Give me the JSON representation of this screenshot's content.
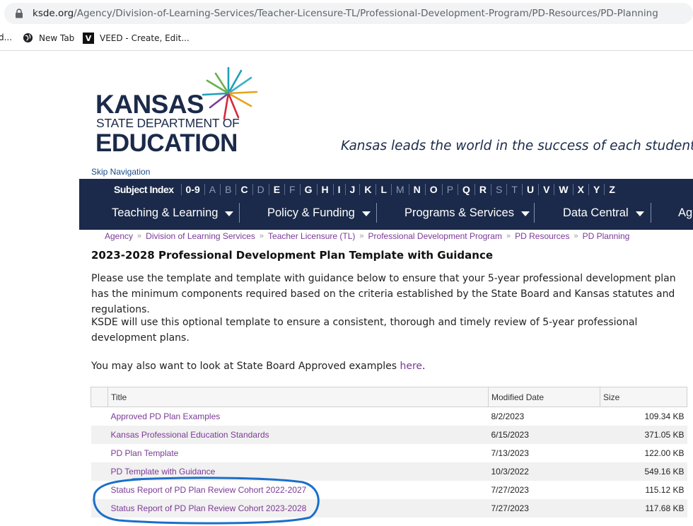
{
  "browser": {
    "url_domain": "ksde.org",
    "url_path": "/Agency/Division-of-Learning-Services/Teacher-Licensure-TL/Professional-Development-Program/PD-Resources/PD-Planning",
    "bookmarks": [
      "d...",
      "New Tab",
      "VEED - Create, Edit..."
    ]
  },
  "header": {
    "logo_line1": "KANSAS",
    "logo_line2": "STATE DEPARTMENT OF",
    "logo_line3": "EDUCATION",
    "tagline": "Kansas leads the world in the success of each student.",
    "skip_nav": "Skip Navigation"
  },
  "nav": {
    "subject_index": "Subject Index",
    "index_items": [
      {
        "label": "0-9",
        "dim": false
      },
      {
        "label": "A",
        "dim": true
      },
      {
        "label": "B",
        "dim": true
      },
      {
        "label": "C",
        "dim": false
      },
      {
        "label": "D",
        "dim": true
      },
      {
        "label": "E",
        "dim": false
      },
      {
        "label": "F",
        "dim": true
      },
      {
        "label": "G",
        "dim": false
      },
      {
        "label": "H",
        "dim": false
      },
      {
        "label": "I",
        "dim": false
      },
      {
        "label": "J",
        "dim": false
      },
      {
        "label": "K",
        "dim": false
      },
      {
        "label": "L",
        "dim": false
      },
      {
        "label": "M",
        "dim": true
      },
      {
        "label": "N",
        "dim": false
      },
      {
        "label": "O",
        "dim": false
      },
      {
        "label": "P",
        "dim": true
      },
      {
        "label": "Q",
        "dim": false
      },
      {
        "label": "R",
        "dim": false
      },
      {
        "label": "S",
        "dim": true
      },
      {
        "label": "T",
        "dim": true
      },
      {
        "label": "U",
        "dim": false
      },
      {
        "label": "V",
        "dim": false
      },
      {
        "label": "W",
        "dim": false
      },
      {
        "label": "X",
        "dim": false
      },
      {
        "label": "Y",
        "dim": false
      },
      {
        "label": "Z",
        "dim": false
      }
    ],
    "menu": [
      "Teaching & Learning",
      "Policy & Funding",
      "Programs & Services",
      "Data Central",
      "Ag"
    ]
  },
  "breadcrumb": [
    "Agency",
    "Division of Learning Services",
    "Teacher Licensure (TL)",
    "Professional Development Program",
    "PD Resources",
    "PD Planning"
  ],
  "page": {
    "title": "2023-2028 Professional Development Plan Template with Guidance",
    "para1": "Please use the template and template with guidance below to ensure that your 5-year professional development plan has the minimum components required based on the criteria established by the State Board and Kansas statutes and regulations.",
    "para2": "KSDE will use this optional template to ensure a consistent, thorough and timely review of 5-year professional development plans.",
    "para3_prefix": "You may also want to look at State Board Approved examples ",
    "para3_link": "here",
    "para3_suffix": "."
  },
  "table": {
    "headers": [
      "Title",
      "Modified Date",
      "Size"
    ],
    "rows": [
      {
        "title": "Approved PD Plan Examples",
        "date": "8/2/2023",
        "size": "109.34 KB"
      },
      {
        "title": "Kansas Professional Education Standards",
        "date": "6/15/2023",
        "size": "371.05 KB"
      },
      {
        "title": "PD Plan Template",
        "date": "7/13/2023",
        "size": "122.00 KB"
      },
      {
        "title": "PD Template with Guidance",
        "date": "10/3/2022",
        "size": "549.16 KB"
      },
      {
        "title": "Status Report of PD Plan Review Cohort 2022-2027",
        "date": "7/27/2023",
        "size": "115.12 KB"
      },
      {
        "title": "Status Report of PD Plan Review Cohort 2023-2028",
        "date": "7/27/2023",
        "size": "117.68 KB"
      }
    ]
  },
  "colors": {
    "navy": "#1b2a4a",
    "link": "#7b3a96",
    "annotation": "#1a6fc9"
  }
}
